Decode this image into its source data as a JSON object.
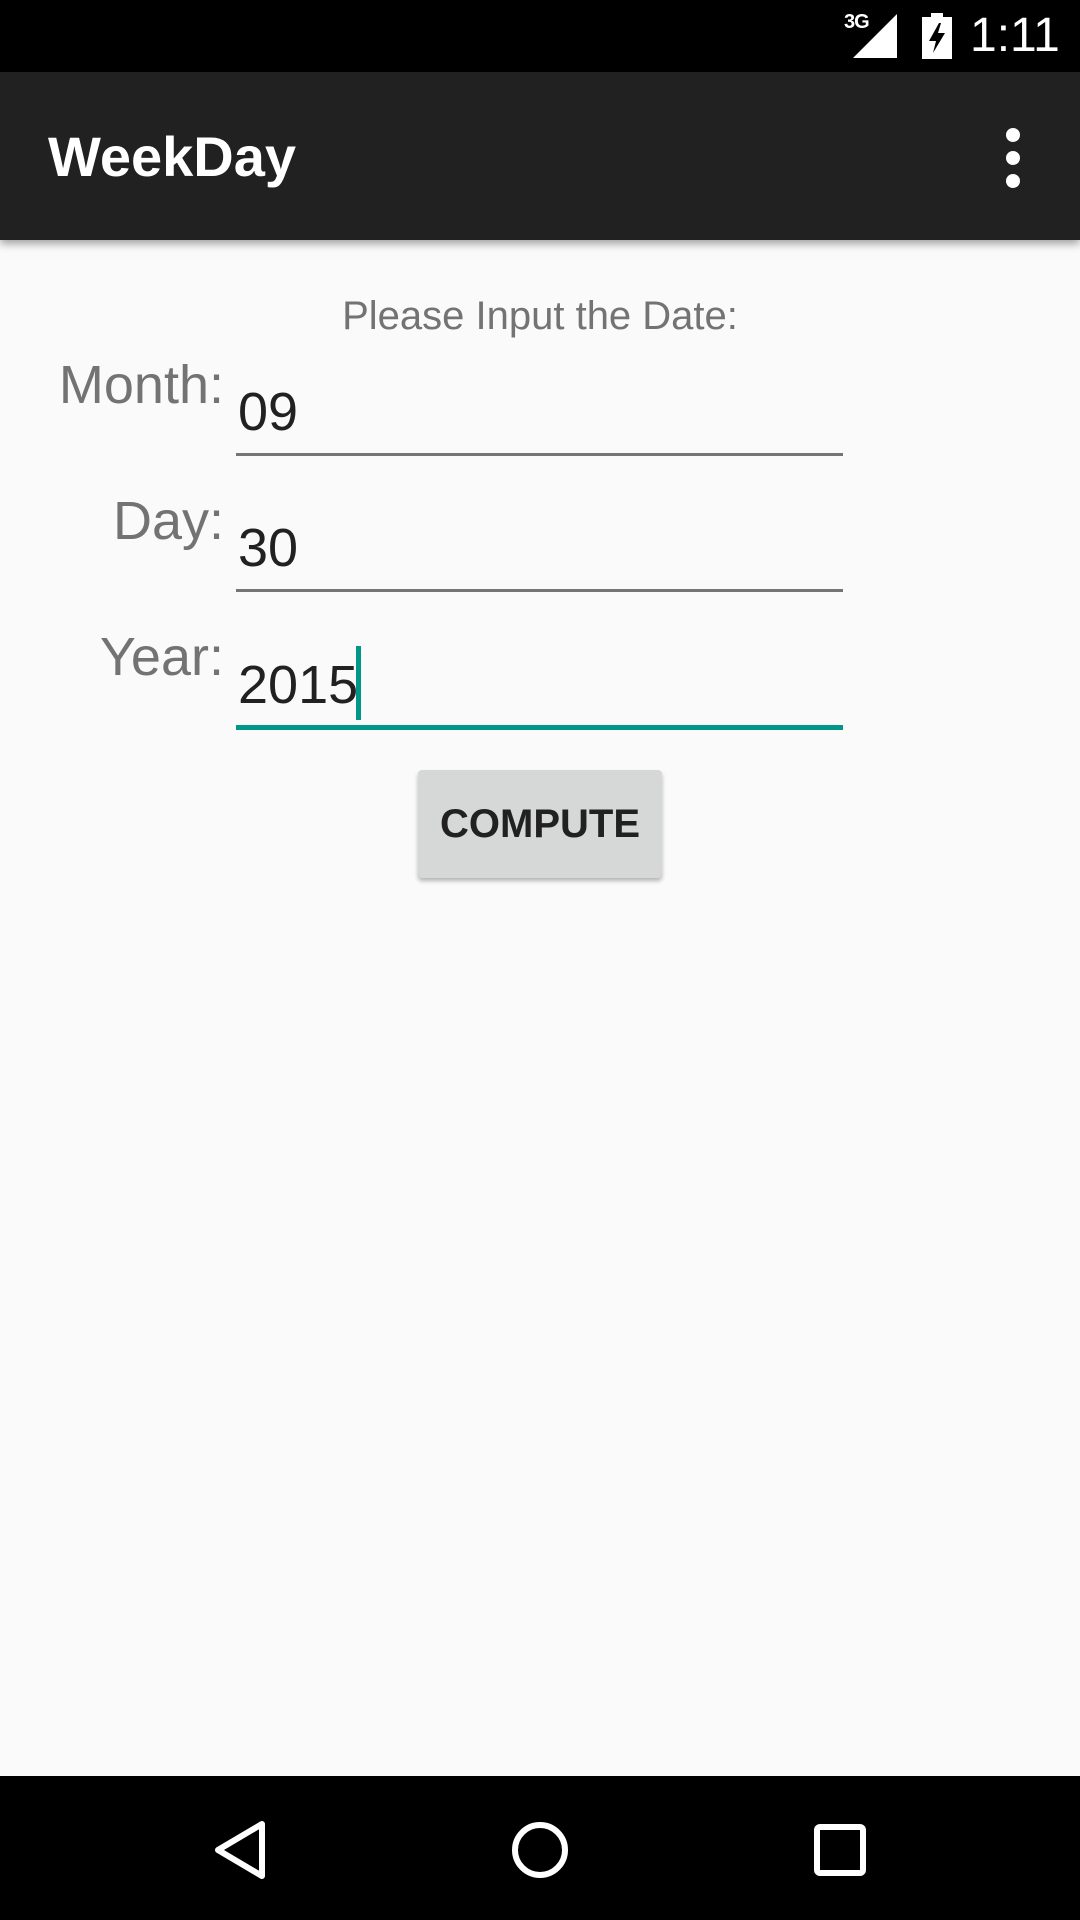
{
  "status_bar": {
    "network": "3G",
    "time": "1:11"
  },
  "app_bar": {
    "title": "WeekDay",
    "overflow_icon": "more-vert-icon"
  },
  "form": {
    "prompt": "Please Input the Date:",
    "month": {
      "label": "Month:",
      "value": "09"
    },
    "day": {
      "label": "Day:",
      "value": "30"
    },
    "year": {
      "label": "Year:",
      "value": "2015"
    },
    "compute_label": "COMPUTE"
  },
  "nav_bar": {
    "back_icon": "back-triangle-icon",
    "home_icon": "home-circle-icon",
    "recents_icon": "recents-square-icon"
  },
  "colors": {
    "accent": "#009688",
    "app_bar": "#212121",
    "background": "#fafafa"
  }
}
